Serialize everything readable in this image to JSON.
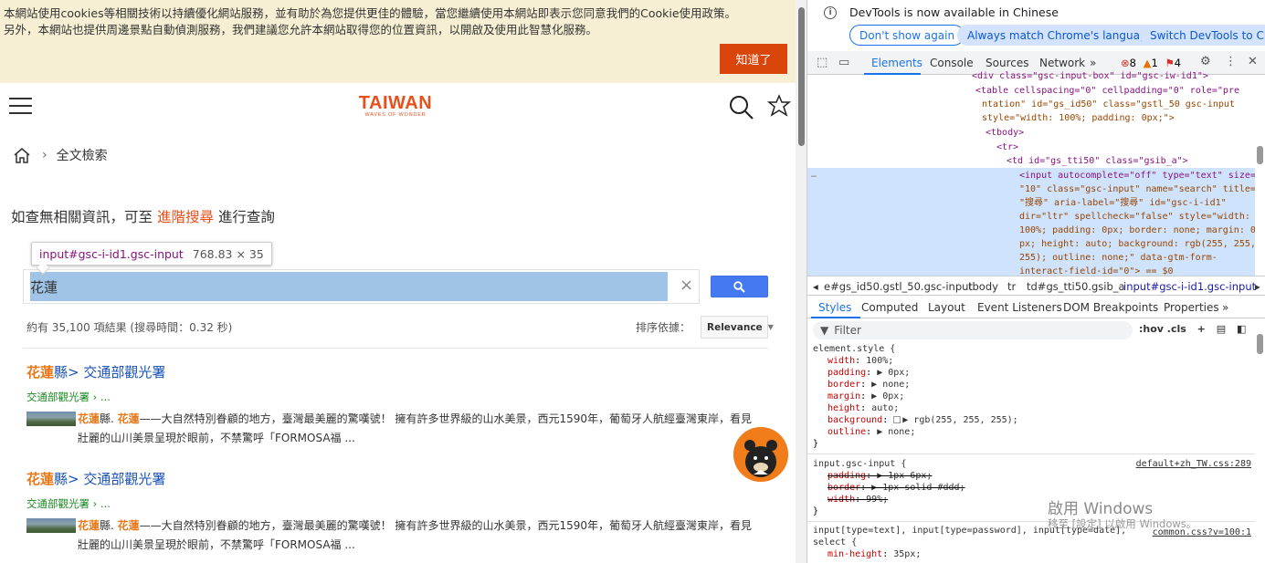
{
  "cookie": {
    "line1": "本網站使用cookies等相關技術以持續優化網站服務，並有助於為您提供更佳的體驗，當您繼續使用本網站即表示您同意我們的Cookie使用政策。",
    "line2": "另外，本網站也提供周邊景點自動偵測服務，我們建議您允許本網站取得您的位置資訊，以開啟及使用此智慧化服務。",
    "button": "知道了"
  },
  "header": {
    "logo_main": "TAIWAN",
    "logo_sub": "WAVES OF WONDER"
  },
  "breadcrumb": {
    "page": "全文檢索"
  },
  "hint": {
    "prefix": "如查無相關資訊，可至 ",
    "link": "進階搜尋",
    "suffix": " 進行查詢"
  },
  "tooltip": {
    "selector": "input#gsc-i-id1.gsc-input",
    "size": "768.83 × 35"
  },
  "search": {
    "value": "花蓮",
    "clear": "×"
  },
  "results_meta": {
    "count": "約有 35,100 項結果 (搜尋時間：0.32 秒)",
    "sort_label": "排序依據：",
    "sort_value": "Relevance"
  },
  "results": [
    {
      "title_hl": "花蓮",
      "title_rest": "縣> 交通部觀光署",
      "url": "交通部觀光署 › ...",
      "snippet_hl1": "花蓮",
      "snippet_a": "縣. ",
      "snippet_hl2": "花蓮",
      "snippet_b": "——大自然特別眷顧的地方，臺灣最美麗的驚嘆號！ 擁有許多世界級的山水美景，西元1590年，葡萄牙人航經臺灣東岸，看見壯麗的山川美景呈現於眼前，不禁驚呼「FORMOSA福 ..."
    },
    {
      "title_hl": "花蓮",
      "title_rest": "縣> 交通部觀光署",
      "url": "交通部觀光署 › ...",
      "snippet_hl1": "花蓮",
      "snippet_a": "縣. ",
      "snippet_hl2": "花蓮",
      "snippet_b": "——大自然特別眷顧的地方，臺灣最美麗的驚嘆號！ 擁有許多世界級的山水美景，西元1590年，葡萄牙人航經臺灣東岸，看見壯麗的山川美景呈現於眼前，不禁驚呼「FORMOSA福 ..."
    }
  ],
  "devtools": {
    "info_text": "DevTools is now available in Chinese",
    "btn_dont_show": "Don't show again",
    "btn_match": "Always match Chrome's language",
    "btn_switch": "Switch DevTools to Chinese",
    "tabs": [
      "Elements",
      "Console",
      "Sources",
      "Network",
      "»"
    ],
    "errors": "8",
    "warnings": "1",
    "issues": "4",
    "dom_lines": [
      "<div class=\"gsc-input-box\" id=\"gsc-iw-id1\">",
      "<table cellspacing=\"0\" cellpadding=\"0\" role=\"pre",
      "ntation\" id=\"gs_id50\" class=\"gstl_50 gsc-input",
      "style=\"width: 100%; padding: 0px;\">",
      "<tbody>",
      "<tr>",
      "<td id=\"gs_tti50\" class=\"gsib_a\">",
      "<input autocomplete=\"off\" type=\"text\" size=",
      "\"10\" class=\"gsc-input\" name=\"search\" title=",
      "\"搜尋\" aria-label=\"搜尋\" id=\"gsc-i-id1\"",
      "dir=\"ltr\" spellcheck=\"false\" style=\"width:",
      "100%; padding: 0px; border: none; margin: 0",
      "px; height: auto; background: rgb(255, 255,",
      "255); outline: none;\" data-gtm-form-",
      "interact-field-id=\"0\"> == $0"
    ],
    "crumbs": [
      "e#gs_id50.gstl_50.gsc-input",
      "tbody",
      "tr",
      "td#gs_tti50.gsib_a",
      "input#gsc-i-id1.gsc-input"
    ],
    "style_tabs": [
      "Styles",
      "Computed",
      "Layout",
      "Event Listeners",
      "DOM Breakpoints",
      "Properties",
      "»"
    ],
    "filter_placeholder": "Filter",
    "filter_tools": ":hov  .cls",
    "rule1_sel": "element.style {",
    "rule1_props": [
      [
        "width",
        "100%;"
      ],
      [
        "padding",
        "▶ 0px;"
      ],
      [
        "border",
        "▶ none;"
      ],
      [
        "margin",
        "▶ 0px;"
      ],
      [
        "height",
        "auto;"
      ],
      [
        "background",
        "▶ rgb(255, 255, 255);"
      ],
      [
        "outline",
        "▶ none;"
      ]
    ],
    "rule2_sel": "input.gsc-input {",
    "rule2_src": "default+zh_TW.css:289",
    "rule2_props": [
      [
        "padding",
        "▶ 1px 6px;"
      ],
      [
        "border",
        "▶ 1px solid #ddd;"
      ],
      [
        "width",
        "99%;"
      ]
    ],
    "rule3_sel": "input[type=text], input[type=password], input[type=date],",
    "rule3_sel2": "select {",
    "rule3_src": "common.css?v=100:1",
    "rule3_prop": [
      "min-height",
      "35px;"
    ],
    "close_brace": "}",
    "watermark1": "啟用 Windows",
    "watermark2": "移至 [設定] 以啟用 Windows。"
  },
  "colors": {
    "brand": "#e8501b",
    "accent": "#1a73e8",
    "selection": "#9fc4e7"
  }
}
